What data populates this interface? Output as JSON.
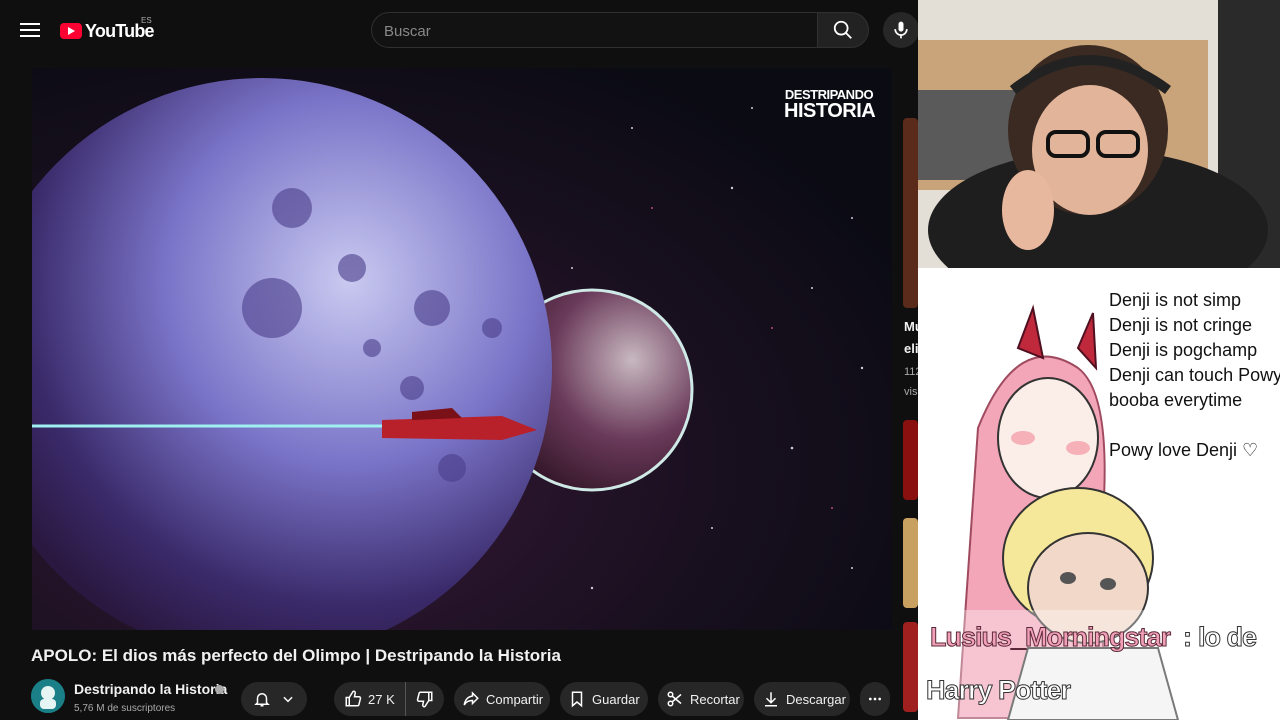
{
  "header": {
    "logo_text": "YouTube",
    "country_code": "ES",
    "search_placeholder": "Buscar"
  },
  "video": {
    "watermark_line1": "DESTRIPANDO",
    "watermark_line2": "HISTORIA",
    "title": "APOLO: El dios más perfecto del Olimpo | Destripando la Historia"
  },
  "channel": {
    "name": "Destripando la Historia",
    "subscribers": "5,76 M de suscriptores"
  },
  "actions": {
    "likes": "27 K",
    "share": "Compartir",
    "save": "Guardar",
    "clip": "Recortar",
    "download": "Descargar"
  },
  "sidebar_peek": {
    "title_line1": "Mu",
    "title_line2": "eli",
    "meta_line1": "112",
    "meta_line2": "vis"
  },
  "meme": {
    "lines": [
      "Denji is not simp",
      "Denji is not cringe",
      "Denji is pogchamp",
      "Denji can touch Powy",
      "booba everytime",
      "",
      "Powy love Denji ♡"
    ]
  },
  "chat": {
    "username": "Lusius_Morningstar",
    "separator": ":",
    "message_line1": "lo de",
    "message_line2": "Harry Potter"
  },
  "colors": {
    "youtube_red": "#ff0033",
    "background": "#0f0f0f",
    "chat_username": "#f2a0b8"
  }
}
